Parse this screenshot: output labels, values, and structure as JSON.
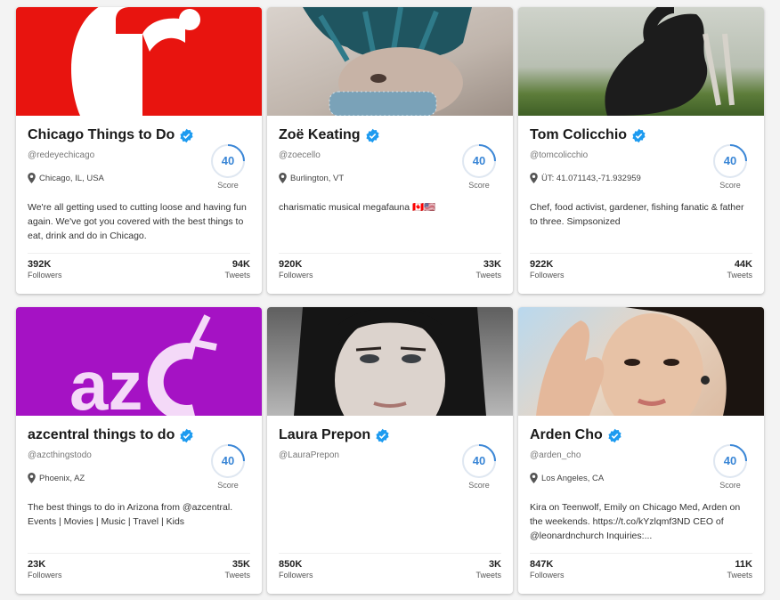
{
  "cards": [
    {
      "name": "Chicago Things to Do",
      "handle": "@redeyechicago",
      "location": "Chicago, IL, USA",
      "score": "40",
      "score_label": "Score",
      "bio": "We're all getting used to cutting loose and having fun again. We've got you covered with the best things to eat, drink and do in Chicago.",
      "followers": "392K",
      "followers_label": "Followers",
      "tweets": "94K",
      "tweets_label": "Tweets"
    },
    {
      "name": "Zoë Keating",
      "handle": "@zoecello",
      "location": "Burlington, VT",
      "score": "40",
      "score_label": "Score",
      "bio": "charismatic musical megafauna 🇨🇦🇺🇸",
      "followers": "920K",
      "followers_label": "Followers",
      "tweets": "33K",
      "tweets_label": "Tweets"
    },
    {
      "name": "Tom Colicchio",
      "handle": "@tomcolicchio",
      "location": "ÜT: 41.071143,-71.932959",
      "score": "40",
      "score_label": "Score",
      "bio": "Chef, food activist, gardener, fishing fanatic & father to three. Simpsonized",
      "followers": "922K",
      "followers_label": "Followers",
      "tweets": "44K",
      "tweets_label": "Tweets"
    },
    {
      "name": "azcentral things to do",
      "handle": "@azcthingstodo",
      "location": "Phoenix, AZ",
      "score": "40",
      "score_label": "Score",
      "bio": "The best things to do in Arizona from @azcentral. Events | Movies | Music | Travel | Kids",
      "followers": "23K",
      "followers_label": "Followers",
      "tweets": "35K",
      "tweets_label": "Tweets"
    },
    {
      "name": "Laura Prepon",
      "handle": "@LauraPrepon",
      "location": "",
      "score": "40",
      "score_label": "Score",
      "bio": "",
      "followers": "850K",
      "followers_label": "Followers",
      "tweets": "3K",
      "tweets_label": "Tweets"
    },
    {
      "name": "Arden Cho",
      "handle": "@arden_cho",
      "location": "Los Angeles, CA",
      "score": "40",
      "score_label": "Score",
      "bio": "Kira on Teenwolf, Emily on Chicago Med, Arden on the weekends. https://t.co/kYzlqmf3ND CEO of @leonardnchurch Inquiries:...",
      "followers": "847K",
      "followers_label": "Followers",
      "tweets": "11K",
      "tweets_label": "Tweets"
    }
  ],
  "colors": {
    "verified": "#1d9bf0",
    "score_ring": "#3a86d6",
    "score_track": "#dfe7f1"
  },
  "icons": {
    "verified": "verified-badge-icon",
    "location": "map-pin-icon"
  }
}
